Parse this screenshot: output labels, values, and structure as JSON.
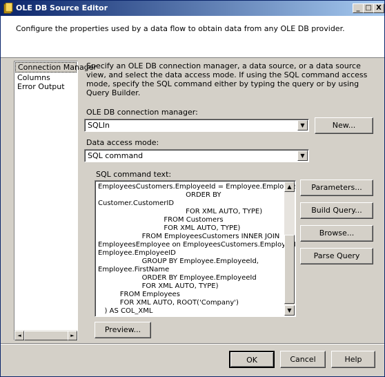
{
  "window": {
    "title": "OLE DB Source Editor",
    "controls": {
      "minimize": "_",
      "maximize": "□",
      "close": "X"
    }
  },
  "header": {
    "description": "Configure the properties used by a data flow to obtain data from any OLE DB provider."
  },
  "nav": {
    "items": [
      {
        "label": "Connection Manager",
        "selected": true
      },
      {
        "label": "Columns",
        "selected": false
      },
      {
        "label": "Error Output",
        "selected": false
      }
    ]
  },
  "main": {
    "instructions": "Specify an OLE DB connection manager, a data source, or a data source view, and select the data access mode. If using the SQL command access mode, specify the SQL command either by typing the query or by using Query Builder.",
    "connection_manager_label": "OLE DB connection manager:",
    "connection_manager_value": "SQLIn",
    "new_button": "New...",
    "access_mode_label": "Data access mode:",
    "access_mode_value": "SQL command",
    "sql_label": "SQL command text:",
    "sql_text": "EmployeesCustomers.EmployeeId = Employee.EmployeeId\n                                        ORDER BY\nCustomer.CustomerID\n                                        FOR XML AUTO, TYPE)\n                              FROM Customers\n                              FOR XML AUTO, TYPE)\n                    FROM EmployeesCustomers INNER JOIN\nEmployeesEmployee on EmployeesCustomers.EmployeeID =\nEmployee.EmployeeID\n                    GROUP BY Employee.EmployeeId,\nEmployee.FirstName\n                    ORDER BY Employee.EmployeeId\n                    FOR XML AUTO, TYPE)\n          FROM Employees\n          FOR XML AUTO, ROOT('Company')\n   ) AS COL_XML",
    "parameters_button": "Parameters...",
    "build_query_button": "Build Query...",
    "browse_button": "Browse...",
    "parse_query_button": "Parse Query",
    "preview_button": "Preview..."
  },
  "footer": {
    "ok": "OK",
    "cancel": "Cancel",
    "help": "Help"
  }
}
